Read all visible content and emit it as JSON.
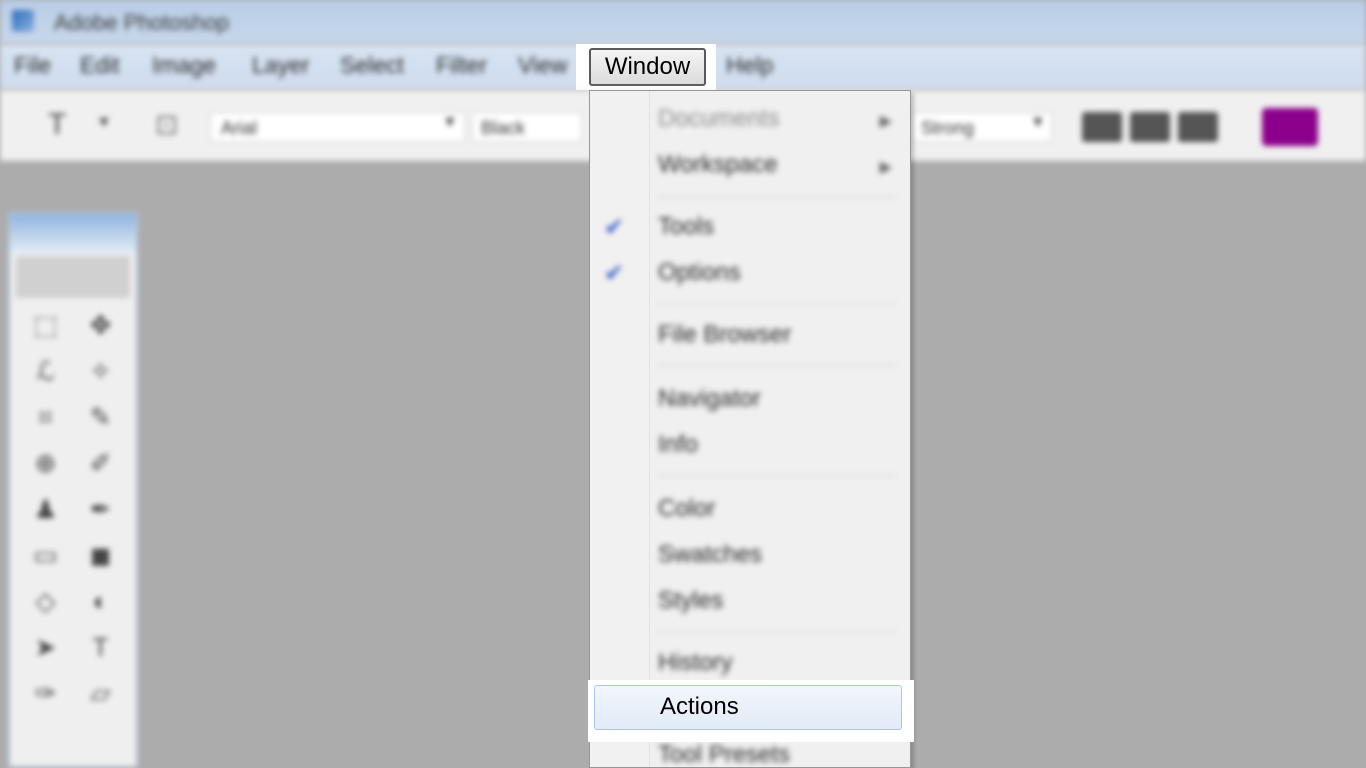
{
  "window": {
    "title": "Adobe Photoshop"
  },
  "menubar": {
    "items": [
      "File",
      "Edit",
      "Image",
      "Layer",
      "Select",
      "Filter",
      "View",
      "Window",
      "Help"
    ],
    "active": "Window"
  },
  "options": {
    "font_family": "Arial",
    "font_style": "Black",
    "anti_alias": "Strong",
    "color": "#8b008b"
  },
  "window_menu": {
    "items": [
      {
        "label": "Documents",
        "disabled": true,
        "submenu": true
      },
      {
        "label": "Workspace",
        "submenu": true
      },
      {
        "label": "Tools",
        "checked": true
      },
      {
        "label": "Options",
        "checked": true
      },
      {
        "label": "File Browser"
      },
      {
        "label": "Navigator"
      },
      {
        "label": "Info"
      },
      {
        "label": "Color"
      },
      {
        "label": "Swatches"
      },
      {
        "label": "Styles"
      },
      {
        "label": "History"
      },
      {
        "label": "Actions",
        "highlighted": true
      },
      {
        "label": "Tool Presets"
      }
    ]
  },
  "icons": {
    "app": "photoshop-icon",
    "check": "checkmark-icon",
    "submenu": "submenu-arrow-icon"
  },
  "colors": {
    "accent_highlight": "#a8c8ec",
    "check_color": "#3358c8"
  }
}
